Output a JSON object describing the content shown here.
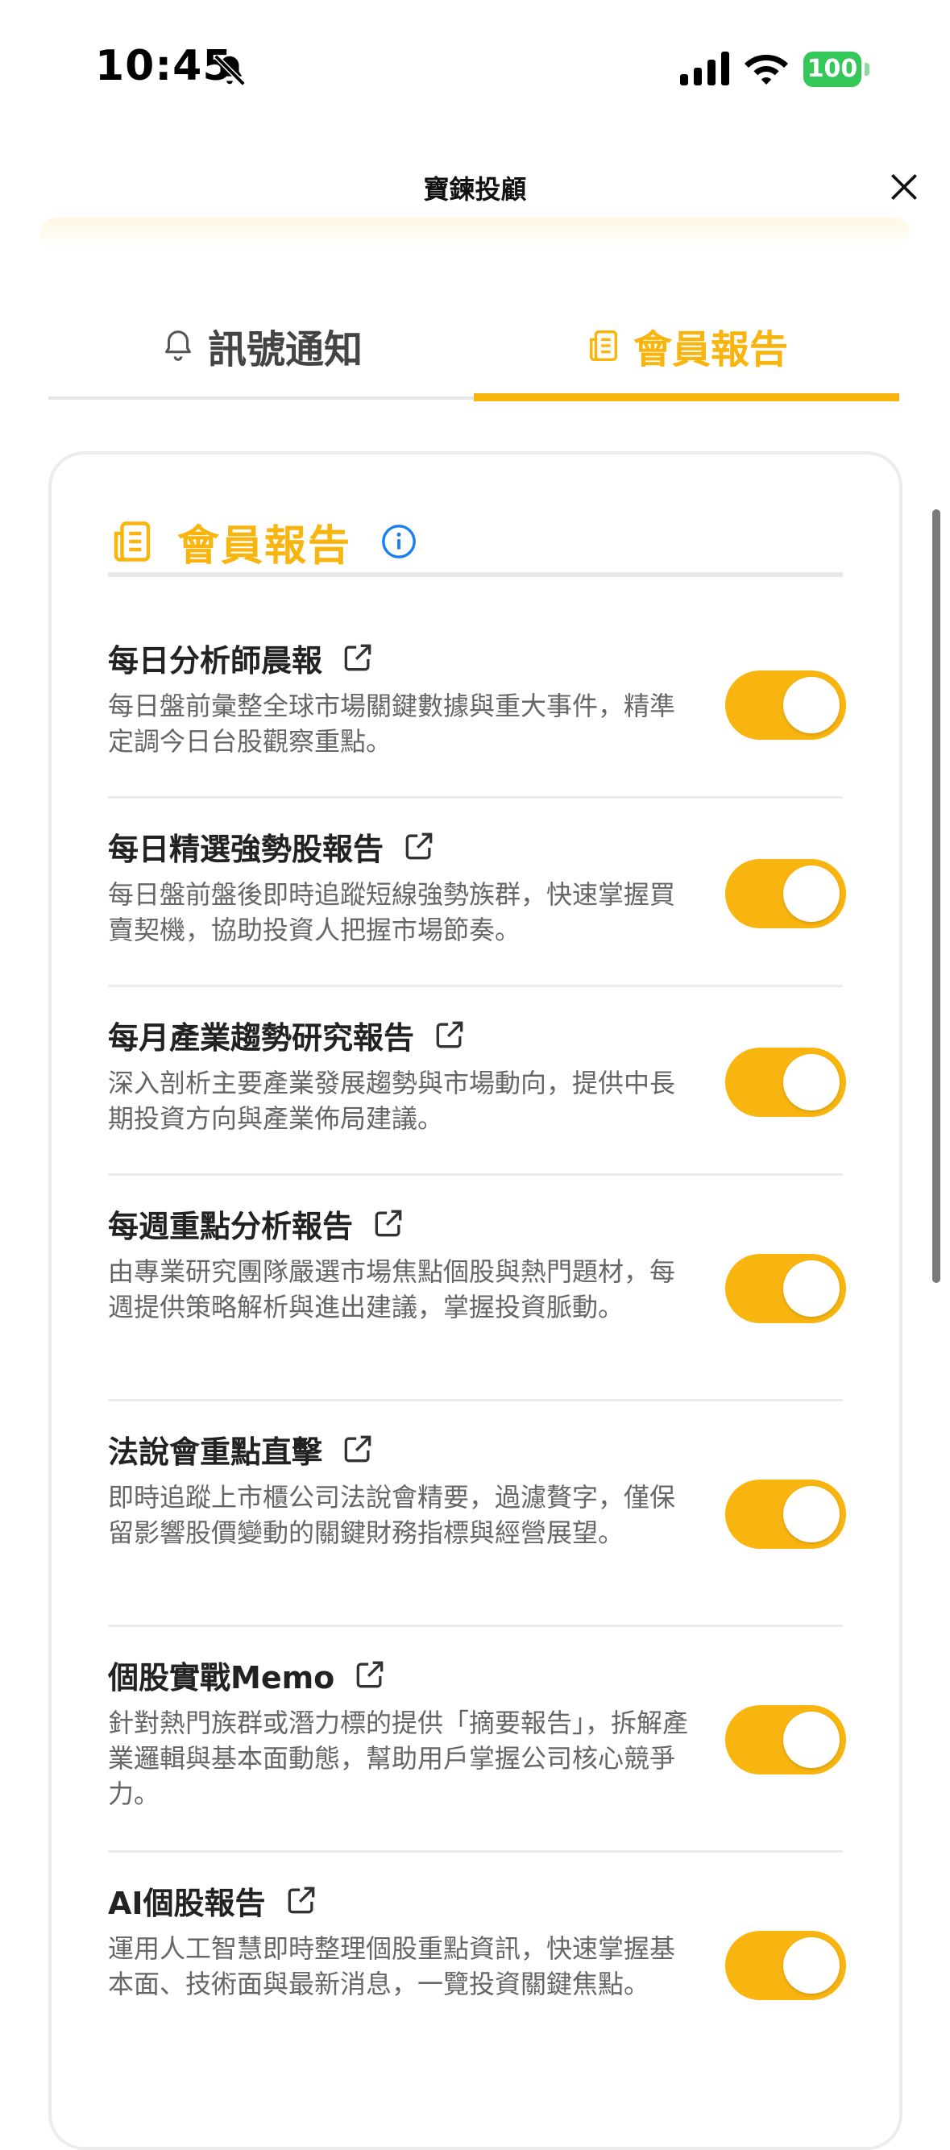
{
  "status_bar": {
    "time": "10:45",
    "battery": "100"
  },
  "header": {
    "title": "寶鍊投顧"
  },
  "tabs": [
    {
      "label": "訊號通知",
      "icon": "bell-icon",
      "active": false
    },
    {
      "label": "會員報告",
      "icon": "report-icon",
      "active": true
    }
  ],
  "card": {
    "title": "會員報告",
    "items": [
      {
        "title": "每日分析師晨報",
        "desc": "每日盤前彙整全球市場關鍵數據與重大事件，精準定調今日台股觀察重點。",
        "enabled": true
      },
      {
        "title": "每日精選強勢股報告",
        "desc": "每日盤前盤後即時追蹤短線強勢族群，快速掌握買賣契機，協助投資人把握市場節奏。",
        "enabled": true
      },
      {
        "title": "每月產業趨勢研究報告",
        "desc": "深入剖析主要產業發展趨勢與市場動向，提供中長期投資方向與產業佈局建議。",
        "enabled": true
      },
      {
        "title": "每週重點分析報告",
        "desc": "由專業研究團隊嚴選市場焦點個股與熱門題材，每週提供策略解析與進出建議，掌握投資脈動。",
        "enabled": true
      },
      {
        "title": "法說會重點直擊",
        "desc": "即時追蹤上市櫃公司法說會精要，過濾贅字，僅保留影響股價變動的關鍵財務指標與經營展望。",
        "enabled": true
      },
      {
        "title": "個股實戰Memo",
        "desc": "針對熱門族群或潛力標的提供「摘要報告」，拆解產業邏輯與基本面動態，幫助用戶掌握公司核心競爭力。",
        "enabled": true
      },
      {
        "title": "AI個股報告",
        "desc": "運用人工智慧即時整理個股重點資訊，快速掌握基本面、技術面與最新消息，一覽投資關鍵焦點。",
        "enabled": true
      }
    ]
  },
  "colors": {
    "accent": "#f9b50f",
    "battery": "#35c759",
    "info": "#1a7ff0"
  }
}
